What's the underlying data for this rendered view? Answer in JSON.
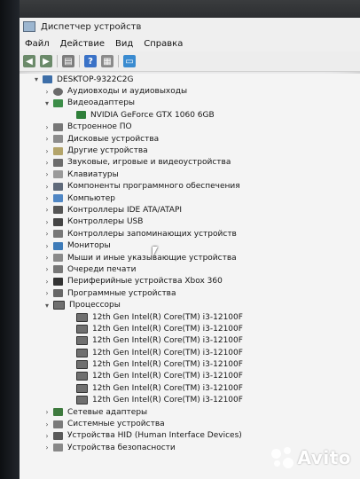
{
  "window": {
    "title": "Диспетчер устройств"
  },
  "menu": [
    "Файл",
    "Действие",
    "Вид",
    "Справка"
  ],
  "toolbar": {
    "help_glyph": "?"
  },
  "tree": [
    {
      "label": "DESKTOP-9322C2G",
      "indent": 1,
      "expander": "▾",
      "icon": "computer-root-icon",
      "cls": "ico-root"
    },
    {
      "label": "Аудиовходы и аудиовыходы",
      "indent": 2,
      "expander": "›",
      "icon": "audio-icon",
      "cls": "ico-audio"
    },
    {
      "label": "Видеоадаптеры",
      "indent": 2,
      "expander": "▾",
      "icon": "display-adapter-icon",
      "cls": "ico-video"
    },
    {
      "label": "NVIDIA GeForce GTX 1060 6GB",
      "indent": 3,
      "expander": "",
      "icon": "gpu-icon",
      "cls": "ico-gpu"
    },
    {
      "label": "Встроенное ПО",
      "indent": 2,
      "expander": "›",
      "icon": "firmware-icon",
      "cls": "ico-fw"
    },
    {
      "label": "Дисковые устройства",
      "indent": 2,
      "expander": "›",
      "icon": "disk-icon",
      "cls": "ico-disk"
    },
    {
      "label": "Другие устройства",
      "indent": 2,
      "expander": "›",
      "icon": "other-devices-icon",
      "cls": "ico-other"
    },
    {
      "label": "Звуковые, игровые и видеоустройства",
      "indent": 2,
      "expander": "›",
      "icon": "sound-icon",
      "cls": "ico-sound"
    },
    {
      "label": "Клавиатуры",
      "indent": 2,
      "expander": "›",
      "icon": "keyboard-icon",
      "cls": "ico-kbd"
    },
    {
      "label": "Компоненты программного обеспечения",
      "indent": 2,
      "expander": "›",
      "icon": "software-component-icon",
      "cls": "ico-sw"
    },
    {
      "label": "Компьютер",
      "indent": 2,
      "expander": "›",
      "icon": "computer-icon",
      "cls": "ico-pc"
    },
    {
      "label": "Контроллеры IDE ATA/ATAPI",
      "indent": 2,
      "expander": "›",
      "icon": "ide-controller-icon",
      "cls": "ico-ide"
    },
    {
      "label": "Контроллеры USB",
      "indent": 2,
      "expander": "›",
      "icon": "usb-icon",
      "cls": "ico-usb"
    },
    {
      "label": "Контроллеры запоминающих устройств",
      "indent": 2,
      "expander": "›",
      "icon": "storage-controller-icon",
      "cls": "ico-stor"
    },
    {
      "label": "Мониторы",
      "indent": 2,
      "expander": "›",
      "icon": "monitor-icon",
      "cls": "ico-mon"
    },
    {
      "label": "Мыши и иные указывающие устройства",
      "indent": 2,
      "expander": "›",
      "icon": "mouse-icon",
      "cls": "ico-mouse"
    },
    {
      "label": "Очереди печати",
      "indent": 2,
      "expander": "›",
      "icon": "print-queue-icon",
      "cls": "ico-print"
    },
    {
      "label": "Периферийные устройства Xbox 360",
      "indent": 2,
      "expander": "›",
      "icon": "xbox-icon",
      "cls": "ico-xbox"
    },
    {
      "label": "Программные устройства",
      "indent": 2,
      "expander": "›",
      "icon": "software-device-icon",
      "cls": "ico-prog"
    },
    {
      "label": "Процессоры",
      "indent": 2,
      "expander": "▾",
      "icon": "processor-icon",
      "cls": "ico-cpu"
    },
    {
      "label": "12th Gen Intel(R) Core(TM) i3-12100F",
      "indent": 3,
      "expander": "",
      "icon": "cpu-core-icon",
      "cls": "ico-cpu"
    },
    {
      "label": "12th Gen Intel(R) Core(TM) i3-12100F",
      "indent": 3,
      "expander": "",
      "icon": "cpu-core-icon",
      "cls": "ico-cpu"
    },
    {
      "label": "12th Gen Intel(R) Core(TM) i3-12100F",
      "indent": 3,
      "expander": "",
      "icon": "cpu-core-icon",
      "cls": "ico-cpu"
    },
    {
      "label": "12th Gen Intel(R) Core(TM) i3-12100F",
      "indent": 3,
      "expander": "",
      "icon": "cpu-core-icon",
      "cls": "ico-cpu"
    },
    {
      "label": "12th Gen Intel(R) Core(TM) i3-12100F",
      "indent": 3,
      "expander": "",
      "icon": "cpu-core-icon",
      "cls": "ico-cpu"
    },
    {
      "label": "12th Gen Intel(R) Core(TM) i3-12100F",
      "indent": 3,
      "expander": "",
      "icon": "cpu-core-icon",
      "cls": "ico-cpu"
    },
    {
      "label": "12th Gen Intel(R) Core(TM) i3-12100F",
      "indent": 3,
      "expander": "",
      "icon": "cpu-core-icon",
      "cls": "ico-cpu"
    },
    {
      "label": "12th Gen Intel(R) Core(TM) i3-12100F",
      "indent": 3,
      "expander": "",
      "icon": "cpu-core-icon",
      "cls": "ico-cpu"
    },
    {
      "label": "Сетевые адаптеры",
      "indent": 2,
      "expander": "›",
      "icon": "network-adapter-icon",
      "cls": "ico-net"
    },
    {
      "label": "Системные устройства",
      "indent": 2,
      "expander": "›",
      "icon": "system-device-icon",
      "cls": "ico-sys"
    },
    {
      "label": "Устройства HID (Human Interface Devices)",
      "indent": 2,
      "expander": "›",
      "icon": "hid-icon",
      "cls": "ico-hid"
    },
    {
      "label": "Устройства безопасности",
      "indent": 2,
      "expander": "›",
      "icon": "security-device-icon",
      "cls": "ico-sec"
    }
  ],
  "watermark": {
    "text": "Avito"
  }
}
